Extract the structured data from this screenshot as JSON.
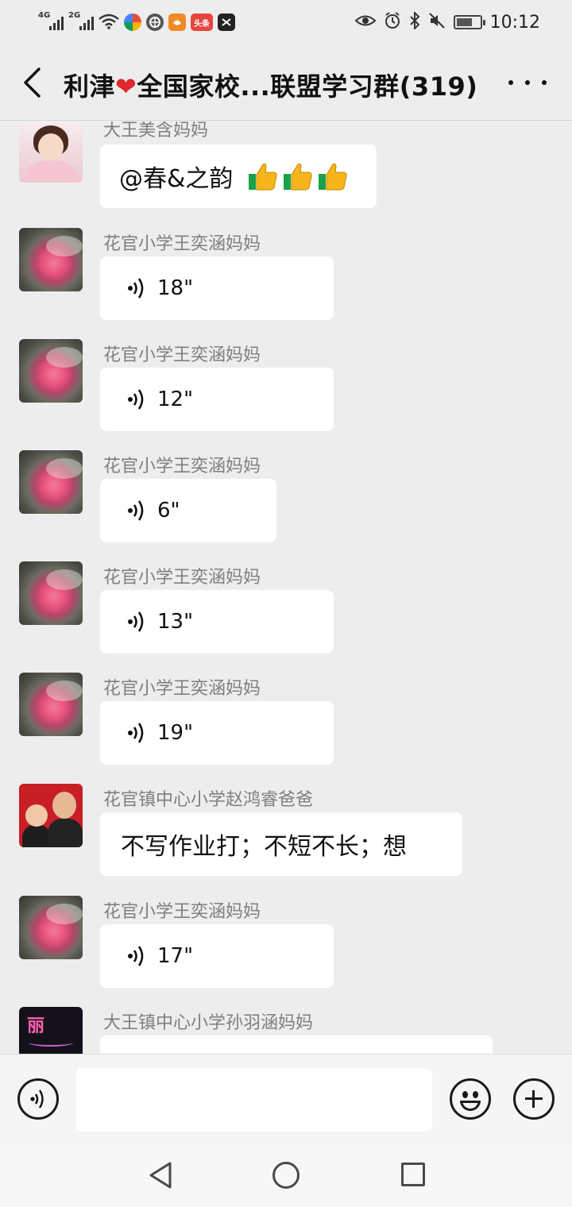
{
  "status_bar": {
    "net1": "4G",
    "net2": "2G",
    "headline_app": "头条",
    "time": "10:12"
  },
  "header": {
    "title_part1": "利津",
    "heart": "❤",
    "title_part2": "全国家校...联盟学习群(319)"
  },
  "messages": [
    {
      "sender": "大王美含妈妈",
      "type": "text",
      "text": "@春&之韵",
      "emoji": "thumbs-up x3"
    },
    {
      "sender": "花官小学王奕涵妈妈",
      "type": "voice",
      "duration": "18\""
    },
    {
      "sender": "花官小学王奕涵妈妈",
      "type": "voice",
      "duration": "12\""
    },
    {
      "sender": "花官小学王奕涵妈妈",
      "type": "voice",
      "duration": "6\""
    },
    {
      "sender": "花官小学王奕涵妈妈",
      "type": "voice",
      "duration": "13\""
    },
    {
      "sender": "花官小学王奕涵妈妈",
      "type": "voice",
      "duration": "19\""
    },
    {
      "sender": "花官镇中心小学赵鸿睿爸爸",
      "type": "text",
      "text": "不写作业打；不短不长；想"
    },
    {
      "sender": "花官小学王奕涵妈妈",
      "type": "voice",
      "duration": "17\""
    },
    {
      "sender": "大王镇中心小学孙羽涵妈妈",
      "type": "text",
      "text": ""
    }
  ],
  "avatars": {
    "neon_char": "丽"
  },
  "input": {
    "value": ""
  }
}
